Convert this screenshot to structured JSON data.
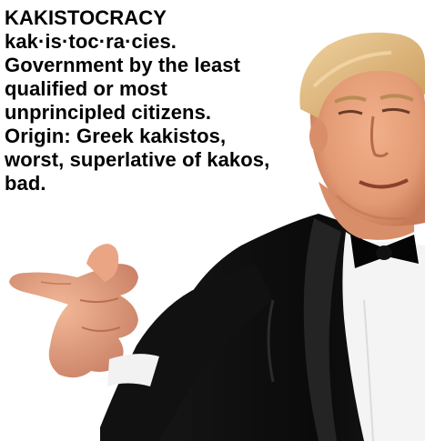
{
  "caption": {
    "lines": [
      "KAKISTOCRACY",
      "kak·is·toc·ra·cies.",
      "Government by the least",
      "qualified or most",
      "unprincipled citizens.",
      "Origin: Greek kakistos,",
      "worst, superlative of kakos,",
      "bad."
    ]
  },
  "photo": {
    "subject": "man-in-tuxedo-pointing",
    "colors": {
      "skin": "#e9a07a",
      "skin_shadow": "#c27555",
      "hair": "#e7c38c",
      "hair_shadow": "#c69a5a",
      "jacket": "#0e0e0e",
      "lapel": "#1f1f1f",
      "shirt": "#f4f4f4",
      "bowtie": "#050505"
    }
  }
}
